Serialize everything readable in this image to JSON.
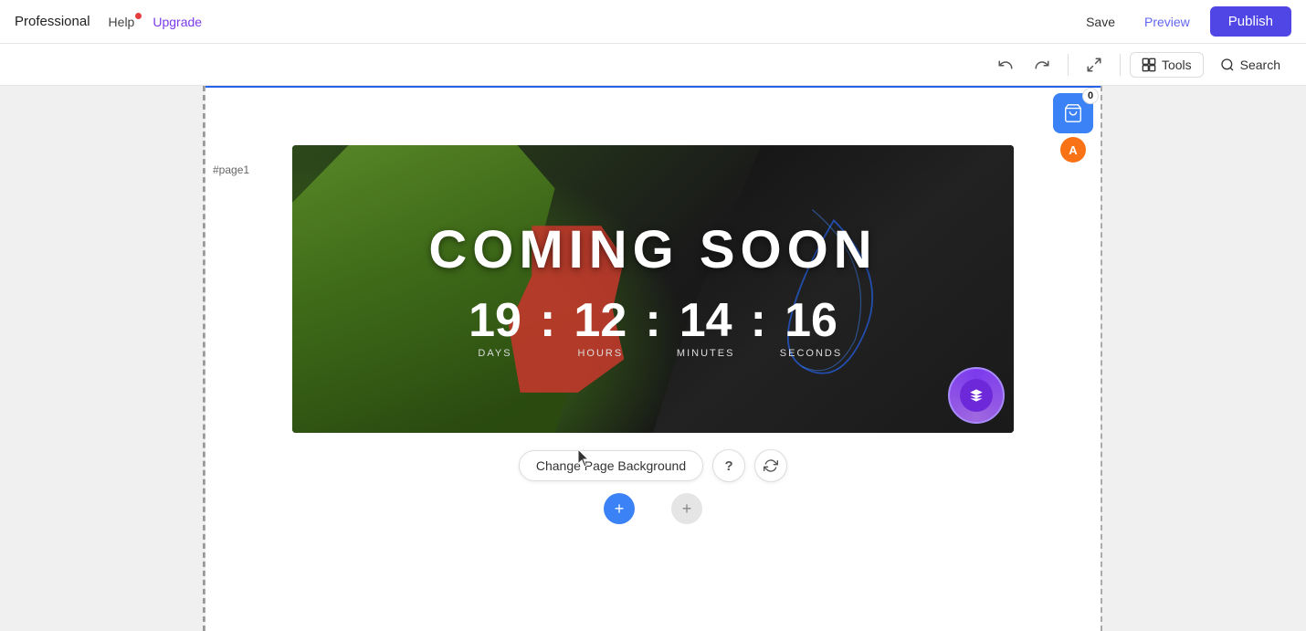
{
  "nav": {
    "brand": "Professional",
    "help": "Help",
    "upgrade": "Upgrade",
    "save": "Save",
    "preview": "Preview",
    "publish": "Publish"
  },
  "toolbar": {
    "tools": "Tools",
    "search": "Search"
  },
  "canvas": {
    "page_label": "#page1",
    "cart_count": "0",
    "avatar_letter": "A"
  },
  "banner": {
    "title": "COMING SOON",
    "days_value": "19",
    "days_label": "DAYS",
    "hours_value": "12",
    "hours_label": "HOURS",
    "minutes_value": "14",
    "minutes_label": "MINUTES",
    "seconds_value": "16",
    "seconds_label": "SECONDS"
  },
  "bottom": {
    "change_bg": "Change Page Background",
    "help_icon": "?",
    "refresh_icon": "↺"
  }
}
